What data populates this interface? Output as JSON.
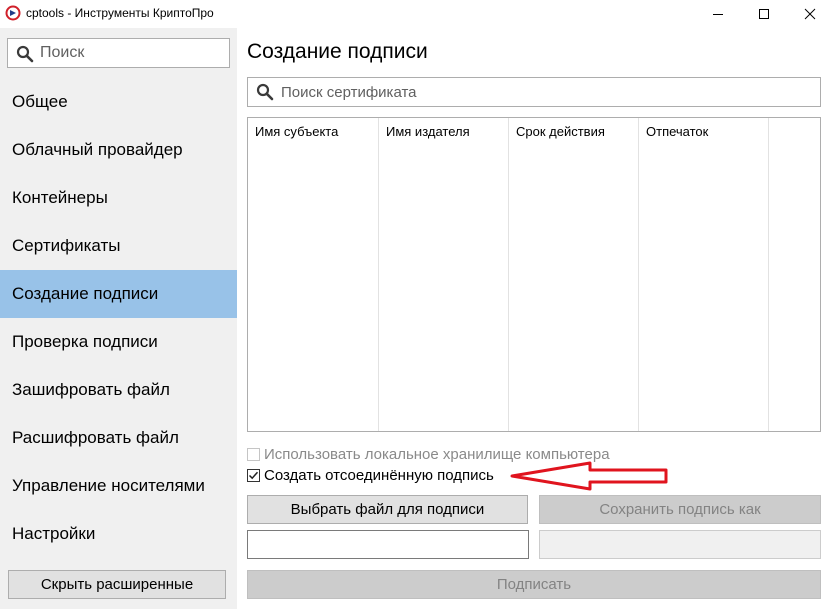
{
  "window": {
    "title": "cptools - Инструменты КриптоПро",
    "icon": "cryptopro-logo-icon"
  },
  "sidebar": {
    "search_placeholder": "Поиск",
    "items": [
      {
        "label": "Общее"
      },
      {
        "label": "Облачный провайдер"
      },
      {
        "label": "Контейнеры"
      },
      {
        "label": "Сертификаты"
      },
      {
        "label": "Создание подписи",
        "active": true
      },
      {
        "label": "Проверка подписи"
      },
      {
        "label": "Зашифровать файл"
      },
      {
        "label": "Расшифровать файл"
      },
      {
        "label": "Управление носителями"
      },
      {
        "label": "Настройки"
      }
    ],
    "hide_button": "Скрыть расширенные"
  },
  "main": {
    "title": "Создание подписи",
    "cert_search_placeholder": "Поиск сертификата",
    "table_columns": [
      "Имя субъекта",
      "Имя издателя",
      "Срок действия",
      "Отпечаток"
    ],
    "use_local_store": {
      "label": "Использовать локальное хранилище компьютера",
      "checked": false,
      "disabled": true
    },
    "detached_signature": {
      "label": "Создать отсоединённую подпись",
      "checked": true,
      "disabled": false
    },
    "choose_file_button": "Выбрать файл для подписи",
    "save_as_button": "Сохранить подпись как",
    "file_path_value": "",
    "save_path_value": "",
    "sign_button": "Подписать"
  },
  "colors": {
    "active_nav": "#98c2e8",
    "sidebar_bg": "#f0f0f0",
    "annotation_arrow": "#e0141e"
  }
}
